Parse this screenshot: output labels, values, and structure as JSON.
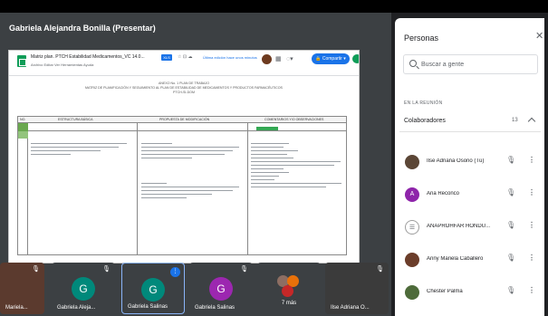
{
  "presenter_label": "Gabriela Alejandra Bonilla (Presentar)",
  "doc": {
    "title": "Matriz plan. PTCH Estabilidad Medicamentos_VC 14.0...",
    "badge": "XLS",
    "small_icons": "☆ ⊡ ☁",
    "menu": "Archivo  Editar  Ver  Herramientas  Ayuda",
    "link": "Última edición hace unos minutos",
    "share_label": "Compartir",
    "header_lines": [
      "ANEXO No. 1 PLAN DE TRABAJO",
      "MATRIZ DE PLANIFICACIÓN Y SEGUIMIENTO AL PLAN DE ESTABILIDAD DE MEDICAMENTOS Y PRODUCTOS FARMACÉUTICOS",
      "PTCH-SI-DOM"
    ],
    "columns": [
      "No.",
      "Estructura Básica",
      "Propuesta de Modificación",
      "Comentarios y/o Observaciones"
    ]
  },
  "tiles": [
    {
      "name": "Mariela...",
      "avatar_letter": "",
      "avatar_color": "#5b3a2e"
    },
    {
      "name": "Gabriela Aleja...",
      "avatar_letter": "G",
      "avatar_color": "#00897b"
    },
    {
      "name": "Gabriela Salinas",
      "avatar_letter": "G",
      "avatar_color": "#00897b"
    },
    {
      "name": "Gabriela Salinas",
      "avatar_letter": "G",
      "avatar_color": "#9c27b0"
    },
    {
      "name": "7 más",
      "avatar_letter": "",
      "avatar_color": "#3c4043"
    },
    {
      "name": "Ilse Adriana O...",
      "avatar_letter": "",
      "avatar_color": "#3b3b3b"
    }
  ],
  "panel": {
    "title": "Personas",
    "close_icon": "close-icon",
    "search_placeholder": "Buscar a gente",
    "section_label": "EN LA REUNIÓN",
    "group_label": "Colaboradores",
    "group_count": "13",
    "people": [
      {
        "name": "Ilse Adriana Osorio (Tú)",
        "avatar_letter": "",
        "avatar_color": "#5b4636"
      },
      {
        "name": "Ana Reconco",
        "avatar_letter": "A",
        "avatar_color": "#8e24aa"
      },
      {
        "name": "ANAPROHFAR HONDU...",
        "avatar_letter": "",
        "avatar_color": "#9e9e9e"
      },
      {
        "name": "Anny Mariela Caballero",
        "avatar_letter": "",
        "avatar_color": "#6b3d2a"
      },
      {
        "name": "Chester Palma",
        "avatar_letter": "",
        "avatar_color": "#4e6b3a"
      }
    ]
  }
}
